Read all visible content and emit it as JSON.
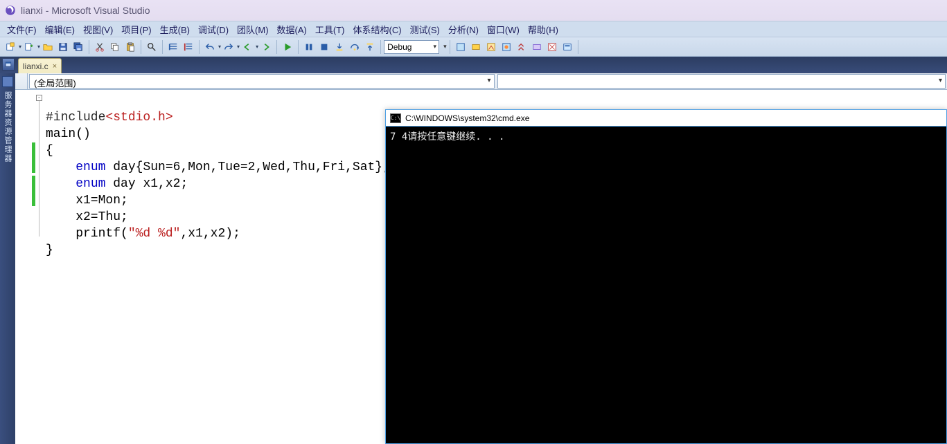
{
  "title": "lianxi - Microsoft Visual Studio",
  "menu": [
    "文件(F)",
    "编辑(E)",
    "视图(V)",
    "项目(P)",
    "生成(B)",
    "调试(D)",
    "团队(M)",
    "数据(A)",
    "工具(T)",
    "体系结构(C)",
    "测试(S)",
    "分析(N)",
    "窗口(W)",
    "帮助(H)"
  ],
  "toolbar": {
    "config_combo": "Debug"
  },
  "sidebar": {
    "label": "服务器资源管理器"
  },
  "tab": {
    "label": "lianxi.c",
    "close": "×"
  },
  "scope": {
    "value": "(全局范围)"
  },
  "code": {
    "l1a": "#include",
    "l1b": "<stdio.h>",
    "l2a": "main",
    "l2b": "()",
    "l3": "{",
    "l4a": "    ",
    "l4kw": "enum",
    "l4b": " day{Sun=6,Mon,Tue=2,Wed,Thu,Fri,Sat};",
    "l5a": "    ",
    "l5kw": "enum",
    "l5b": " day x1,x2;",
    "l6": "    x1=Mon;",
    "l7": "    x2=Thu;",
    "l8a": "    printf(",
    "l8s": "\"%d %d\"",
    "l8b": ",x1,x2);",
    "l9": "}"
  },
  "cmd": {
    "title": "C:\\WINDOWS\\system32\\cmd.exe",
    "icon_text": "C:\\",
    "output": "7 4请按任意键继续. . ."
  }
}
